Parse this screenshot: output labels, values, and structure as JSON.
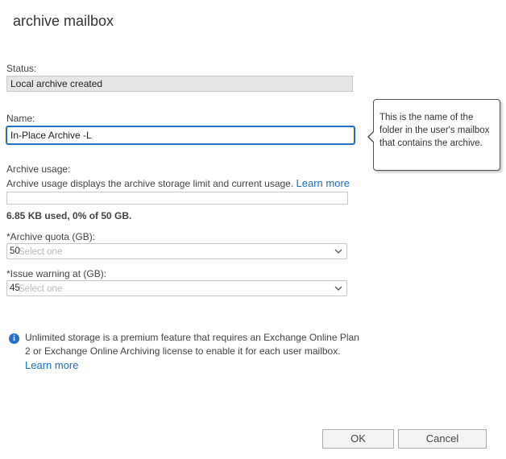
{
  "dialog": {
    "title": "archive mailbox"
  },
  "status": {
    "label": "Status:",
    "value": "Local archive created"
  },
  "name": {
    "label": "Name:",
    "value": "In-Place Archive -L"
  },
  "tooltip": {
    "text": "This is the name of the folder in the user's mailbox that contains the archive."
  },
  "usage": {
    "label": "Archive usage:",
    "description": "Archive usage displays the archive storage limit and current usage.",
    "learn_more": "Learn more",
    "summary": "6.85 KB used, 0% of 50 GB.",
    "percent_used": 0
  },
  "quota": {
    "label": "*Archive quota (GB):",
    "value": "50",
    "placeholder": "Select one"
  },
  "warning": {
    "label": "*Issue warning at (GB):",
    "value": "45",
    "placeholder": "Select one"
  },
  "info": {
    "icon": "info-icon",
    "text": "Unlimited storage is a premium feature that requires an Exchange Online Plan 2 or Exchange Online Archiving license to enable it for each user mailbox.",
    "learn_more": "Learn more",
    "accent": "#2670c9"
  },
  "buttons": {
    "ok": "OK",
    "cancel": "Cancel"
  }
}
